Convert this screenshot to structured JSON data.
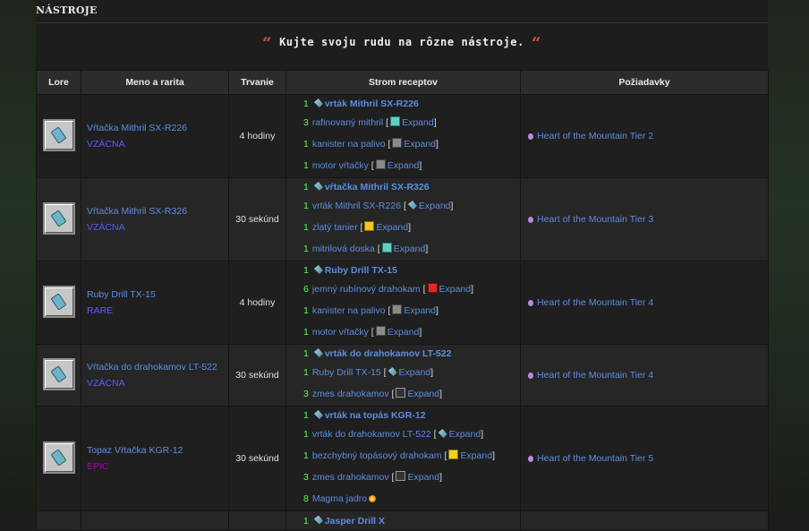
{
  "page": {
    "title": "NÁSTROJE",
    "quote": "Kujte svoju rudu na rôzne nástroje."
  },
  "table": {
    "headers": [
      "Lore",
      "Meno a rarita",
      "Trvanie",
      "Strom receptov",
      "Požiadavky"
    ],
    "rows": [
      {
        "name": "Vŕtačka Mithril SX-R226",
        "rarity": "VZÁCNA",
        "rarity_class": "rare",
        "duration": "4 hodiny",
        "tree": [
          {
            "qty": "1",
            "name": "vrták Mithril SX-R226",
            "icon": "drill-icon",
            "bold": true
          },
          {
            "qty": "3",
            "name": "rafinovaný mithril",
            "icon": "mithril-icon",
            "expand": "Expand"
          },
          {
            "qty": "1",
            "name": "kanister na palivo",
            "icon": "canister-icon",
            "expand": "Expand"
          },
          {
            "qty": "1",
            "name": "motor vŕtačky",
            "icon": "canister-icon",
            "expand": "Expand"
          }
        ],
        "requirement": "Heart of the Mountain Tier 2"
      },
      {
        "name": "Vŕtačka Mithril SX-R326",
        "rarity": "VZÁCNA",
        "rarity_class": "rare",
        "duration": "30 sekúnd",
        "tree": [
          {
            "qty": "1",
            "name": "vŕtačka Mithril SX-R326",
            "icon": "drill-icon",
            "bold": true
          },
          {
            "qty": "1",
            "name": "vrták Mithril SX-R226",
            "icon": "drill-icon",
            "expand": "Expand"
          },
          {
            "qty": "1",
            "name": "zlatý tanier",
            "icon": "gold-icon",
            "expand": "Expand"
          },
          {
            "qty": "1",
            "name": "mitrilová doska",
            "icon": "mithril-icon",
            "expand": "Expand"
          }
        ],
        "requirement": "Heart of the Mountain Tier 3"
      },
      {
        "name": "Ruby Drill TX-15",
        "rarity": "RARE",
        "rarity_class": "rare",
        "duration": "4 hodiny",
        "tree": [
          {
            "qty": "1",
            "name": "Ruby Drill TX-15",
            "icon": "drill-icon",
            "bold": true
          },
          {
            "qty": "6",
            "name": "jemný rubínový drahokam",
            "icon": "ruby-icon",
            "expand": "Expand"
          },
          {
            "qty": "1",
            "name": "kanister na palivo",
            "icon": "canister-icon",
            "expand": "Expand"
          },
          {
            "qty": "1",
            "name": "motor vŕtačky",
            "icon": "canister-icon",
            "expand": "Expand"
          }
        ],
        "requirement": "Heart of the Mountain Tier 4"
      },
      {
        "name": "Vŕtačka do drahokamov LT-522",
        "rarity": "VZÁCNA",
        "rarity_class": "rare",
        "duration": "30 sekúnd",
        "tree": [
          {
            "qty": "1",
            "name": "vrták do drahokamov LT-522",
            "icon": "drill-icon",
            "bold": true
          },
          {
            "qty": "1",
            "name": "Ruby Drill TX-15",
            "icon": "drill-icon",
            "expand": "Expand"
          },
          {
            "qty": "3",
            "name": "zmes drahokamov",
            "icon": "mix-icon",
            "expand": "Expand"
          }
        ],
        "requirement": "Heart of the Mountain Tier 4"
      },
      {
        "name": "Topaz Vŕtačka KGR-12",
        "rarity": "EPIC",
        "rarity_class": "epic",
        "duration": "30 sekúnd",
        "tree": [
          {
            "qty": "1",
            "name": "vrták na topás KGR-12",
            "icon": "drill-icon",
            "bold": true
          },
          {
            "qty": "1",
            "name": "vrták do drahokamov LT-522",
            "icon": "drill-icon",
            "expand": "Expand"
          },
          {
            "qty": "1",
            "name": "bezchybný topásový drahokam",
            "icon": "topaz-icon",
            "expand": "Expand"
          },
          {
            "qty": "3",
            "name": "zmes drahokamov",
            "icon": "mix-icon",
            "expand": "Expand"
          },
          {
            "qty": "8",
            "name": "Magma jadro",
            "icon": "magma-icon"
          }
        ],
        "requirement": "Heart of the Mountain Tier 5"
      },
      {
        "name": "",
        "rarity": "",
        "rarity_class": "rare",
        "duration": "",
        "tree": [
          {
            "qty": "1",
            "name": "Jasper Drill X",
            "icon": "drill-icon",
            "bold": true
          }
        ],
        "requirement": ""
      }
    ]
  }
}
